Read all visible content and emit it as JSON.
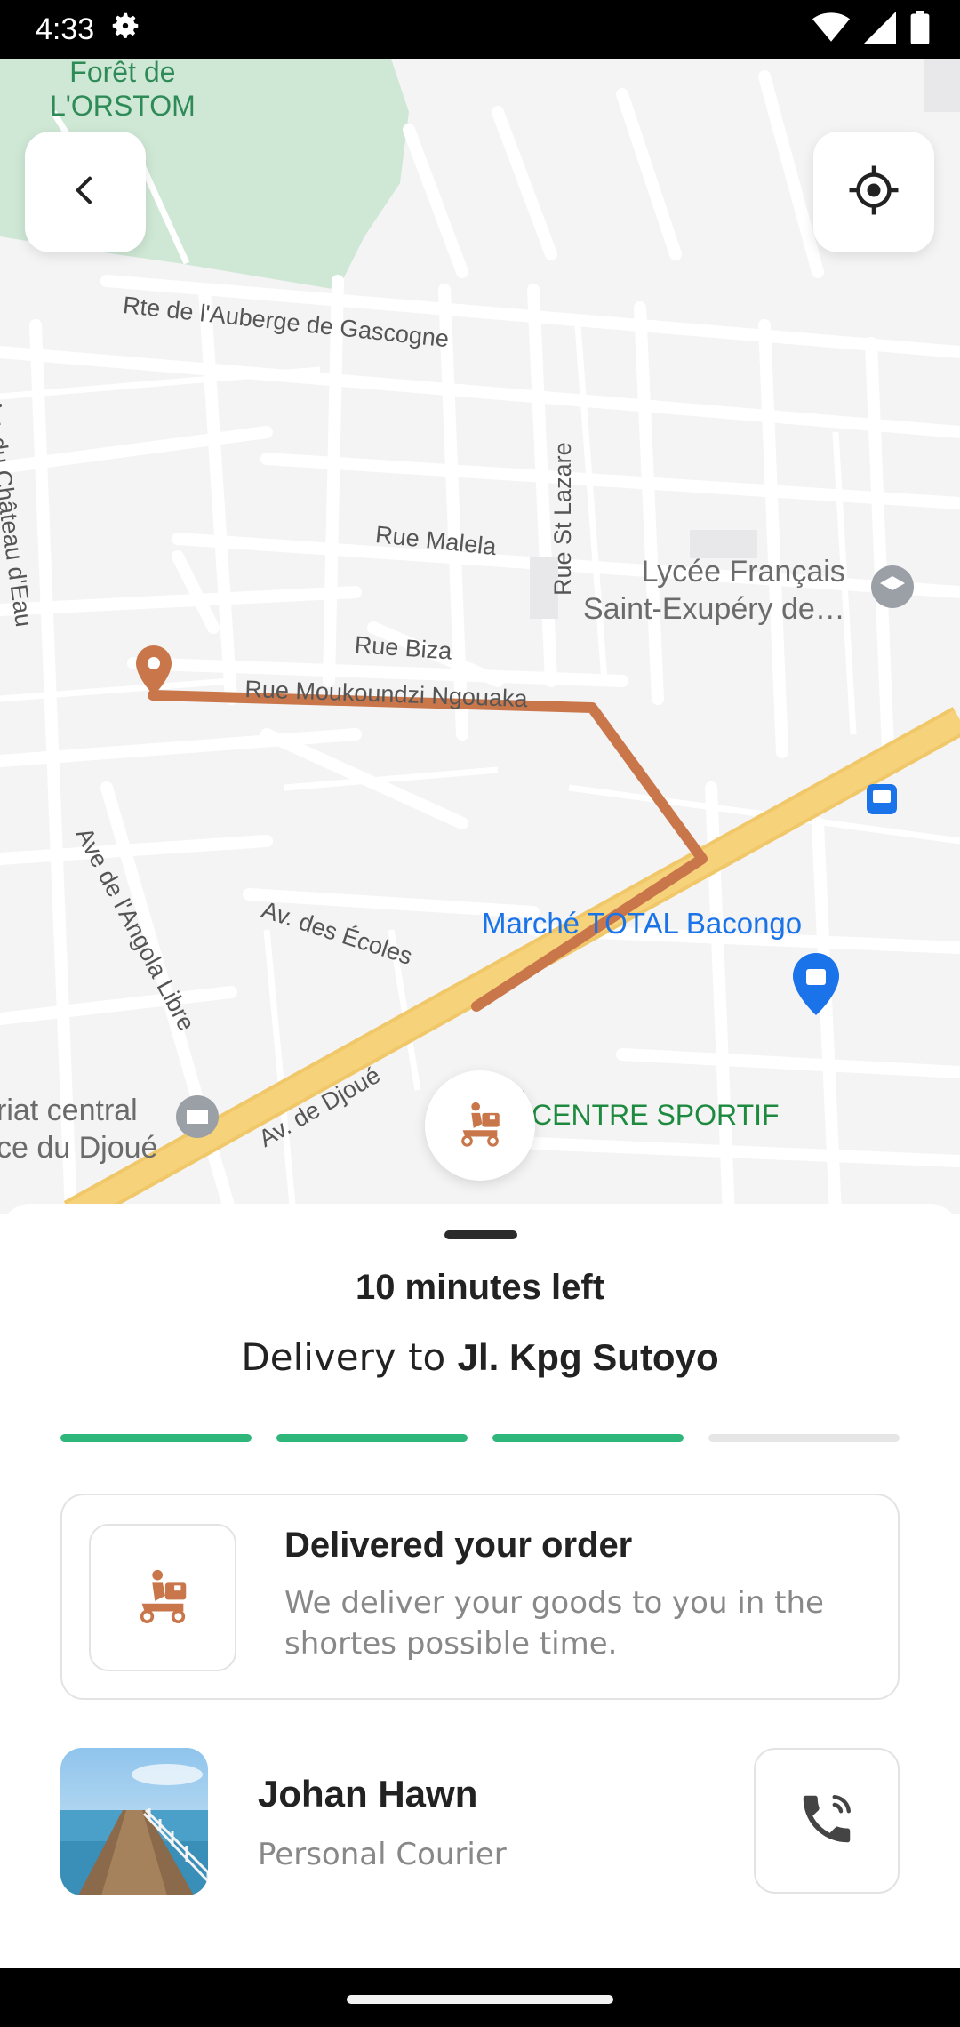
{
  "status_bar": {
    "time": "4:33",
    "icons": [
      "settings-icon",
      "wifi-icon",
      "signal-icon",
      "battery-icon"
    ]
  },
  "map": {
    "labels": {
      "forest": "Forêt de\nL'ORSTOM",
      "rte_auberge": "Rte de l'Auberge de Gascogne",
      "av_chateau": "Av. du Château d'Eau",
      "rue_malela": "Rue Malela",
      "rue_st_lazare": "Rue St Lazare",
      "lycee": "Lycée Français\nSaint-Exupéry de…",
      "rue_biza": "Rue Biza",
      "rue_moukoundzi": "Rue Moukoundzi Ngouaka",
      "ave_angola": "Ave de l'Angola Libre",
      "av_ecoles": "Av. des Écoles",
      "marche": "Marché TOTAL Bacongo",
      "av_djoue": "Av. de Djoué",
      "centre_sportif": "CENTRE SPORTIF",
      "secretariat": "riat central\nce du Djoué"
    },
    "route_color": "#c9774a",
    "road_major_color": "#f6d27a"
  },
  "buttons": {
    "back_icon": "chevron-left-icon",
    "locate_icon": "crosshair-icon"
  },
  "sheet": {
    "time_left": "10 minutes left",
    "delivery_prefix": "Delivery to ",
    "delivery_address": "Jl. Kpg Sutoyo",
    "progress": {
      "completed": 3,
      "total": 4
    },
    "status": {
      "title": "Delivered your order",
      "description": "We deliver your goods to you in the shortes possible time."
    },
    "courier": {
      "name": "Johan Hawn",
      "role": "Personal Courier"
    }
  },
  "colors": {
    "accent_orange": "#c9774a",
    "progress_green": "#2fb67a",
    "park_green": "#cfe7d5",
    "poi_blue": "#1a73e8"
  }
}
